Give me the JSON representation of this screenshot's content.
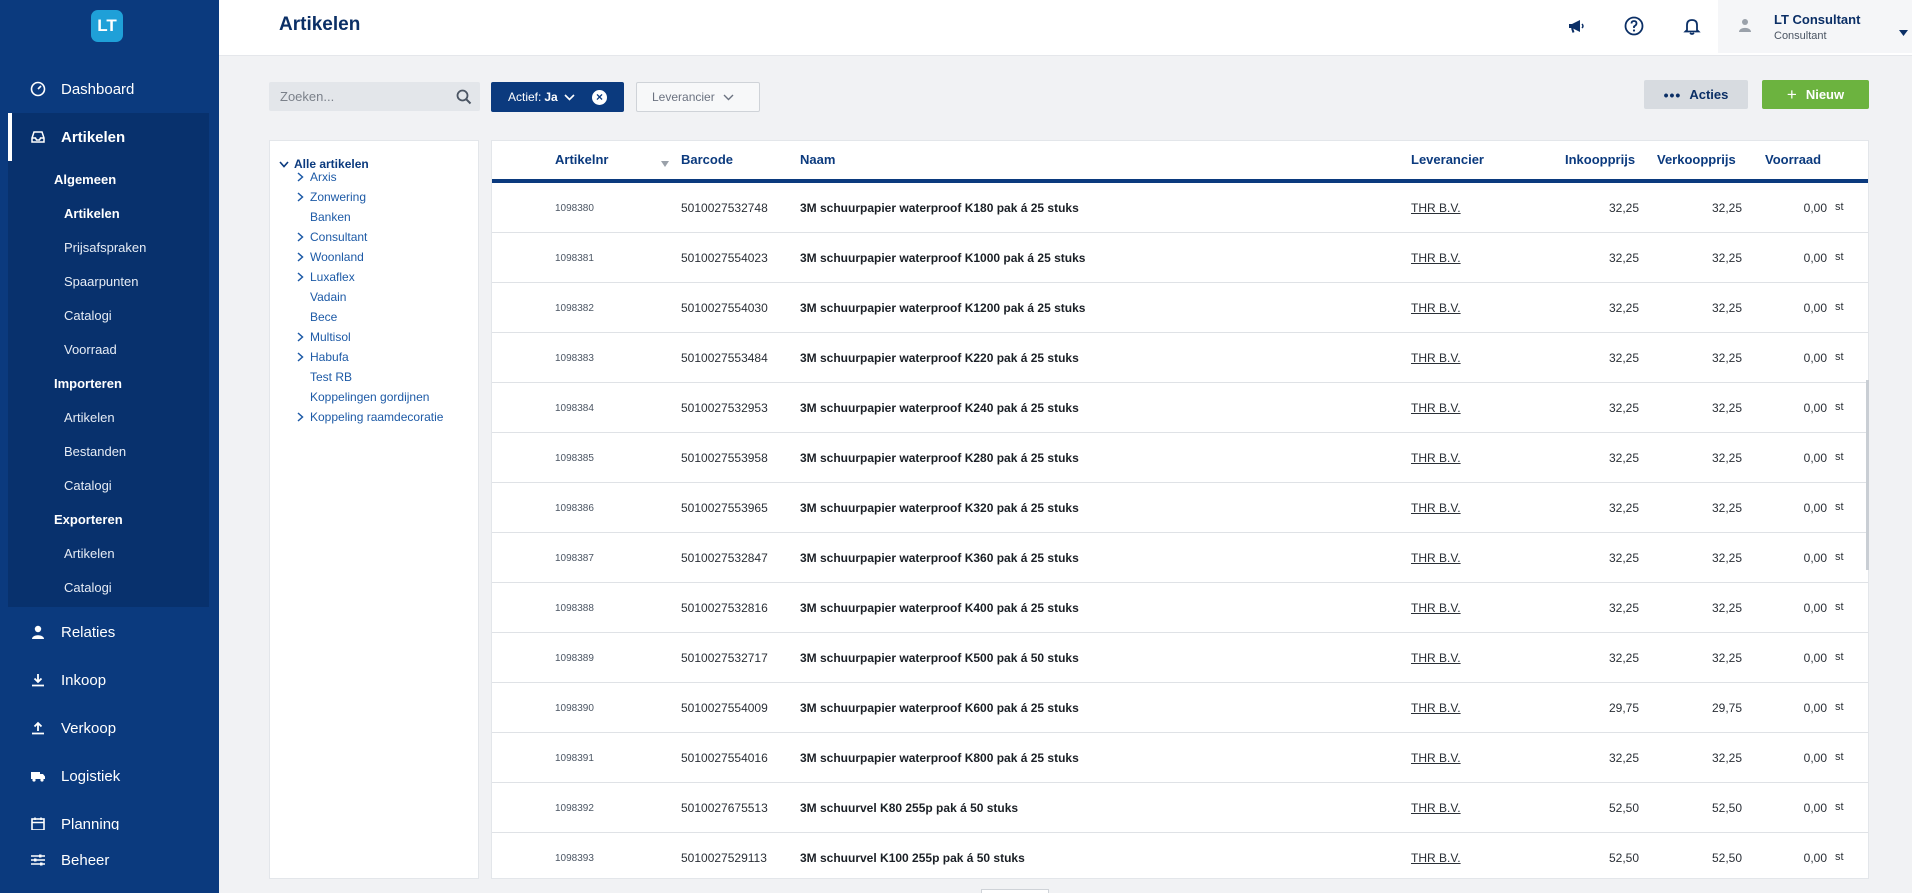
{
  "app": {
    "logo_text": "LT"
  },
  "sidebar": {
    "items": [
      {
        "label": "Dashboard",
        "icon": "dashboard-icon"
      },
      {
        "label": "Artikelen",
        "icon": "inbox-icon"
      },
      {
        "label": "Relaties",
        "icon": "user-icon"
      },
      {
        "label": "Inkoop",
        "icon": "download-icon"
      },
      {
        "label": "Verkoop",
        "icon": "upload-icon"
      },
      {
        "label": "Logistiek",
        "icon": "truck-icon"
      },
      {
        "label": "Planning",
        "icon": "calendar-icon"
      },
      {
        "label": "Beheer",
        "icon": "sliders-icon"
      }
    ],
    "submenu": {
      "algemeen": "Algemeen",
      "algemeen_items": [
        "Artikelen",
        "Prijsafspraken",
        "Spaarpunten",
        "Catalogi",
        "Voorraad"
      ],
      "importeren": "Importeren",
      "importeren_items": [
        "Artikelen",
        "Bestanden",
        "Catalogi"
      ],
      "exporteren": "Exporteren",
      "exporteren_items": [
        "Artikelen",
        "Catalogi"
      ]
    }
  },
  "header": {
    "title": "Artikelen",
    "user_name": "LT Consultant",
    "user_role": "Consultant"
  },
  "toolbar": {
    "search_placeholder": "Zoeken...",
    "filter_chip_label": "Actief:",
    "filter_chip_value": "Ja",
    "supplier_dropdown": "Leverancier",
    "acties_label": "Acties",
    "nieuw_label": "Nieuw"
  },
  "tree": {
    "root": "Alle artikelen",
    "nodes": [
      {
        "label": "Arxis",
        "expandable": true
      },
      {
        "label": "Zonwering",
        "expandable": true
      },
      {
        "label": "Banken",
        "expandable": false
      },
      {
        "label": "Consultant",
        "expandable": true
      },
      {
        "label": "Woonland",
        "expandable": true
      },
      {
        "label": "Luxaflex",
        "expandable": true
      },
      {
        "label": "Vadain",
        "expandable": false
      },
      {
        "label": "Bece",
        "expandable": false
      },
      {
        "label": "Multisol",
        "expandable": true
      },
      {
        "label": "Habufa",
        "expandable": true
      },
      {
        "label": "Test RB",
        "expandable": false
      },
      {
        "label": "Koppelingen gordijnen",
        "expandable": false
      },
      {
        "label": "Koppeling raamdecoratie",
        "expandable": true
      }
    ]
  },
  "table": {
    "columns": {
      "artikelnr": "Artikelnr",
      "barcode": "Barcode",
      "naam": "Naam",
      "leverancier": "Leverancier",
      "inkoopprijs": "Inkoopprijs",
      "verkoopprijs": "Verkoopprijs",
      "voorraad": "Voorraad"
    },
    "rows": [
      {
        "artikelnr": "1098380",
        "barcode": "5010027532748",
        "naam": "3M schuurpapier waterproof K180 pak á 25 stuks",
        "leverancier": "THR B.V.",
        "inkoopprijs": "32,25",
        "verkoopprijs": "32,25",
        "voorraad": "0,00",
        "eenheid": "st"
      },
      {
        "artikelnr": "1098381",
        "barcode": "5010027554023",
        "naam": "3M schuurpapier waterproof K1000 pak á 25 stuks",
        "leverancier": "THR B.V.",
        "inkoopprijs": "32,25",
        "verkoopprijs": "32,25",
        "voorraad": "0,00",
        "eenheid": "st"
      },
      {
        "artikelnr": "1098382",
        "barcode": "5010027554030",
        "naam": "3M schuurpapier waterproof K1200 pak á 25 stuks",
        "leverancier": "THR B.V.",
        "inkoopprijs": "32,25",
        "verkoopprijs": "32,25",
        "voorraad": "0,00",
        "eenheid": "st"
      },
      {
        "artikelnr": "1098383",
        "barcode": "5010027553484",
        "naam": "3M schuurpapier waterproof K220 pak á 25 stuks",
        "leverancier": "THR B.V.",
        "inkoopprijs": "32,25",
        "verkoopprijs": "32,25",
        "voorraad": "0,00",
        "eenheid": "st"
      },
      {
        "artikelnr": "1098384",
        "barcode": "5010027532953",
        "naam": "3M schuurpapier waterproof K240 pak á 25 stuks",
        "leverancier": "THR B.V.",
        "inkoopprijs": "32,25",
        "verkoopprijs": "32,25",
        "voorraad": "0,00",
        "eenheid": "st"
      },
      {
        "artikelnr": "1098385",
        "barcode": "5010027553958",
        "naam": "3M schuurpapier waterproof K280 pak á 25 stuks",
        "leverancier": "THR B.V.",
        "inkoopprijs": "32,25",
        "verkoopprijs": "32,25",
        "voorraad": "0,00",
        "eenheid": "st"
      },
      {
        "artikelnr": "1098386",
        "barcode": "5010027553965",
        "naam": "3M schuurpapier waterproof K320 pak á 25 stuks",
        "leverancier": "THR B.V.",
        "inkoopprijs": "32,25",
        "verkoopprijs": "32,25",
        "voorraad": "0,00",
        "eenheid": "st"
      },
      {
        "artikelnr": "1098387",
        "barcode": "5010027532847",
        "naam": "3M schuurpapier waterproof K360 pak á 25 stuks",
        "leverancier": "THR B.V.",
        "inkoopprijs": "32,25",
        "verkoopprijs": "32,25",
        "voorraad": "0,00",
        "eenheid": "st"
      },
      {
        "artikelnr": "1098388",
        "barcode": "5010027532816",
        "naam": "3M schuurpapier waterproof K400 pak á 25 stuks",
        "leverancier": "THR B.V.",
        "inkoopprijs": "32,25",
        "verkoopprijs": "32,25",
        "voorraad": "0,00",
        "eenheid": "st"
      },
      {
        "artikelnr": "1098389",
        "barcode": "5010027532717",
        "naam": "3M schuurpapier waterproof K500 pak á 50 stuks",
        "leverancier": "THR B.V.",
        "inkoopprijs": "32,25",
        "verkoopprijs": "32,25",
        "voorraad": "0,00",
        "eenheid": "st"
      },
      {
        "artikelnr": "1098390",
        "barcode": "5010027554009",
        "naam": "3M schuurpapier waterproof K600 pak á 25 stuks",
        "leverancier": "THR B.V.",
        "inkoopprijs": "29,75",
        "verkoopprijs": "29,75",
        "voorraad": "0,00",
        "eenheid": "st"
      },
      {
        "artikelnr": "1098391",
        "barcode": "5010027554016",
        "naam": "3M schuurpapier waterproof K800 pak á 25 stuks",
        "leverancier": "THR B.V.",
        "inkoopprijs": "32,25",
        "verkoopprijs": "32,25",
        "voorraad": "0,00",
        "eenheid": "st"
      },
      {
        "artikelnr": "1098392",
        "barcode": "5010027675513",
        "naam": "3M schuurvel K80 255p pak á 50 stuks",
        "leverancier": "THR B.V.",
        "inkoopprijs": "52,50",
        "verkoopprijs": "52,50",
        "voorraad": "0,00",
        "eenheid": "st"
      },
      {
        "artikelnr": "1098393",
        "barcode": "5010027529113",
        "naam": "3M schuurvel K100 255p pak á 50 stuks",
        "leverancier": "THR B.V.",
        "inkoopprijs": "52,50",
        "verkoopprijs": "52,50",
        "voorraad": "0,00",
        "eenheid": "st"
      }
    ]
  },
  "colors": {
    "nav": "#0b3a7e",
    "accent_green": "#6cb33f",
    "logo": "#1fa0d8"
  }
}
